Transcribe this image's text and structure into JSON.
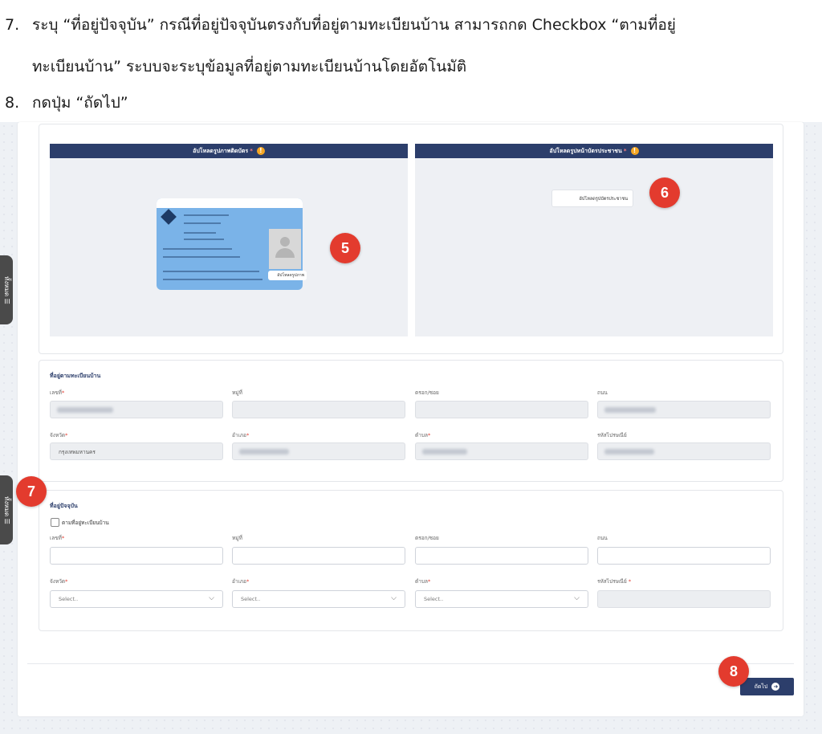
{
  "instructions": {
    "step7_num": "7.",
    "step7_line1": "ระบุ “ที่อยู่ปัจจุบัน” กรณีที่อยู่ปัจจุบันตรงกับที่อยู่ตามทะเบียนบ้าน สามารถกด Checkbox “ตามที่อยู่",
    "step7_line2": "ทะเบียนบ้าน” ระบบจะระบุข้อมูลที่อยู่ตามทะเบียนบ้านโดยอัตโนมัติ",
    "step8_num": "8.",
    "step8_text": "กดปุ่ม “ถัดไป”"
  },
  "uploads": {
    "left_title": "อัปโหลดรูปภาพติดบัตร",
    "right_title": "อัปโหลดรูปหน้าบัตรประชาชน",
    "left_button": "อัปโหลดรูปภาพ",
    "right_button": "อัปโหลดรูปบัตรประชาชน",
    "required_mark": "*",
    "warn_glyph": "!"
  },
  "badges": {
    "b5": "5",
    "b6": "6",
    "b7": "7",
    "b8": "8"
  },
  "sidetab": {
    "label": "ทั้งหมด ☰"
  },
  "registered": {
    "title": "ที่อยู่ตามทะเบียนบ้าน",
    "labels": {
      "house_no": "เลขที่",
      "moo": "หมู่ที่",
      "soi": "ตรอก/ซอย",
      "road": "ถนน",
      "province": "จังหวัด",
      "district": "อำเภอ",
      "subdistrict": "ตำบล",
      "postcode": "รหัสไปรษณีย์"
    },
    "province_value": "กรุงเทพมหานคร"
  },
  "current": {
    "title": "ที่อยู่ปัจจุบัน",
    "checkbox_label": "ตามที่อยู่ทะเบียนบ้าน",
    "labels": {
      "house_no": "เลขที่",
      "moo": "หมู่ที่",
      "soi": "ตรอก/ซอย",
      "road": "ถนน",
      "province": "จังหวัด",
      "district": "อำเภอ",
      "subdistrict": "ตำบล",
      "postcode": "รหัสไปรษณีย์"
    },
    "select_placeholder": "Select..",
    "chevron": "⌵"
  },
  "footer": {
    "next_button": "ถัดไป",
    "next_icon": "➜"
  },
  "colors": {
    "header_bg": "#2c3e6b",
    "badge": "#e33b2e",
    "warn": "#f5a623"
  }
}
